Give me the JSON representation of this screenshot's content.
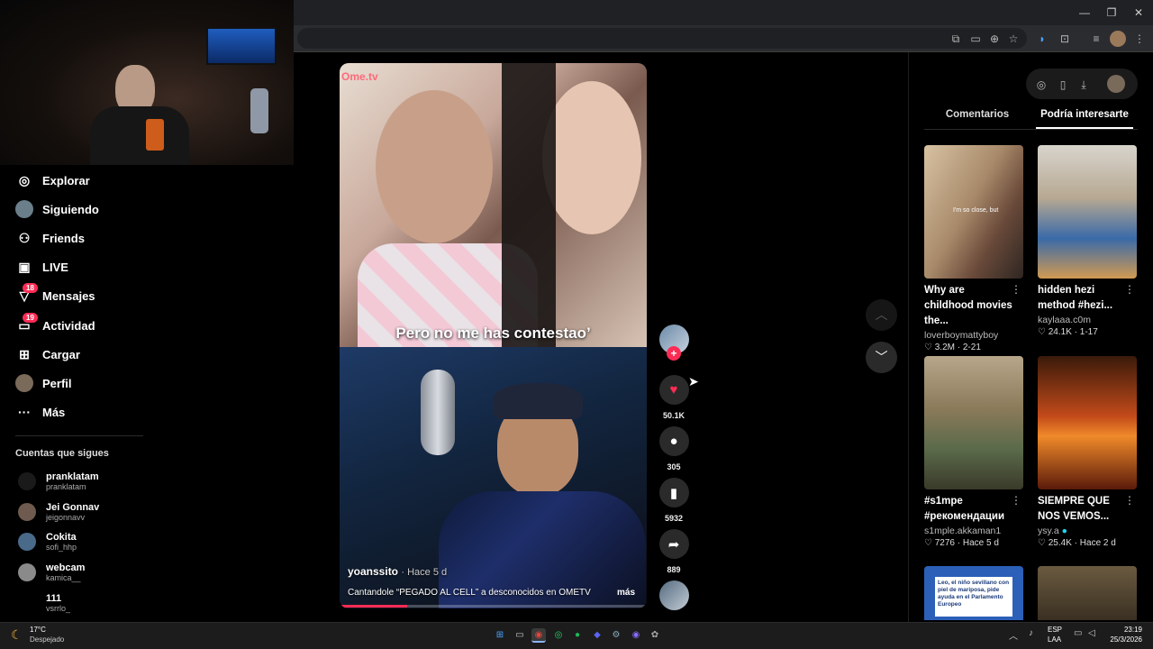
{
  "browser": {
    "window_buttons": [
      "—",
      "❐",
      "✕"
    ]
  },
  "sidebar": {
    "nav": [
      {
        "label": "Explorar",
        "icon": "compass-icon",
        "glyph": "◎"
      },
      {
        "label": "Siguiendo",
        "icon": "following-avatar-icon",
        "glyph": "●"
      },
      {
        "label": "Friends",
        "icon": "friends-icon",
        "glyph": "⚇"
      },
      {
        "label": "LIVE",
        "icon": "live-tv-icon",
        "glyph": "▣"
      },
      {
        "label": "Mensajes",
        "icon": "messages-icon",
        "glyph": "▽",
        "badge": "18"
      },
      {
        "label": "Actividad",
        "icon": "activity-icon",
        "glyph": "▭",
        "badge": "19"
      },
      {
        "label": "Cargar",
        "icon": "upload-plus-icon",
        "glyph": "⊞"
      },
      {
        "label": "Perfil",
        "icon": "profile-avatar-icon",
        "glyph": "●"
      },
      {
        "label": "Más",
        "icon": "more-dots-icon",
        "glyph": "···"
      }
    ],
    "following_title": "Cuentas que sigues",
    "following": [
      {
        "name": "pranklatam",
        "handle": "pranklatam"
      },
      {
        "name": "Jei Gonnav",
        "handle": "jeigonnavv"
      },
      {
        "name": "Cokita",
        "handle": "sofi_hhp"
      },
      {
        "name": "webcam",
        "handle": "kamica__"
      },
      {
        "name": "111",
        "handle": "vsrrlo_"
      }
    ]
  },
  "video": {
    "watermark": "Ome.tv",
    "subtitle": "Pero no me has contestao’",
    "author": "yoanssito",
    "posted": "· Hace 5 d",
    "caption": "Cantandole “PEGADO AL CELL” a desconocidos en OMETV",
    "more": "más",
    "progress": 0.22
  },
  "actions": {
    "likes": "50.1K",
    "comments": "305",
    "saves": "5932",
    "shares": "889"
  },
  "panel": {
    "tabs": [
      "Comentarios",
      "Podría interesarte"
    ],
    "active_tab": 1,
    "cards": [
      {
        "title": "Why are childhood movies the...",
        "user": "loverboymattyboy",
        "likes": "3.2M",
        "date": "2-21",
        "thumb_text": "I'm so close, but"
      },
      {
        "title": "hidden hezi method #hezi...",
        "user": "kaylaaa.c0m",
        "likes": "24.1K",
        "date": "1-17"
      },
      {
        "title": "#s1mpe #рекомендации",
        "user": "s1mple.akkaman1",
        "likes": "7276",
        "date": "Hace 5 d"
      },
      {
        "title": "SIEMPRE QUE NOS VEMOS...",
        "user": "ysy.a",
        "likes": "25.4K",
        "date": "Hace 2 d",
        "verified": true
      },
      {
        "thumb_text": "Leo, el niño sevillano con piel de mariposa, pide ayuda en el Parlamento Europeo"
      },
      {}
    ]
  },
  "taskbar": {
    "weather_temp": "17°C",
    "weather_desc": "Despejado",
    "lang_top": "ESP",
    "lang_bottom": "LAA",
    "time": "23:19",
    "date": "25/3/2026"
  },
  "colors": {
    "accent": "#fe2c55",
    "bg": "#000000",
    "like": "#fe2c55"
  }
}
